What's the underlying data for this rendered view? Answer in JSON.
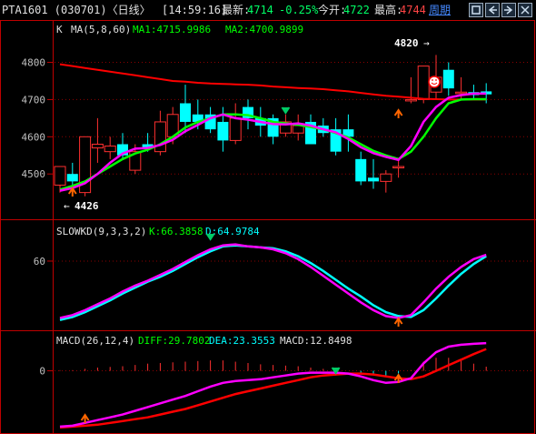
{
  "title_bar": {
    "symbol_title": "PTA1601 (030701)〈日线〉",
    "time": "[14:59:16]",
    "latest_label": "最新:",
    "latest_value": "4714",
    "change_pct": "-0.25%",
    "open_label": "今开:",
    "open_value": "4722",
    "high_label": "最高:",
    "high_value": "4744",
    "period_link": "周期",
    "nav_buttons": [
      "box-icon",
      "arrow-left-icon",
      "arrow-right-icon",
      "close-icon"
    ]
  },
  "colors": {
    "up": "#ff3030",
    "down": "#00ffff",
    "ma1": "#ff00ff",
    "ma2": "#00ff00",
    "ma3": "#ff0000",
    "grid": "#8b0000",
    "axis_text": "#c0c0c0"
  },
  "chart_data": [
    {
      "type": "candlestick",
      "panel": "main",
      "legend_prefix": "K",
      "legend_ma_params": "MA(5,8,60)",
      "legend_ma1": "MA1:4715.9986",
      "legend_ma2": "MA2:4700.9899",
      "y_ticks": [
        "4800",
        "4700",
        "4600",
        "4500"
      ],
      "ylim": [
        4410,
        4860
      ],
      "annotation_high": "4820",
      "annotation_low": "4426",
      "candles": [
        {
          "o": 4470,
          "h": 4520,
          "l": 4450,
          "c": 4520
        },
        {
          "o": 4500,
          "h": 4530,
          "l": 4470,
          "c": 4480
        },
        {
          "o": 4450,
          "h": 4600,
          "l": 4440,
          "c": 4600
        },
        {
          "o": 4570,
          "h": 4650,
          "l": 4530,
          "c": 4580
        },
        {
          "o": 4560,
          "h": 4600,
          "l": 4540,
          "c": 4575
        },
        {
          "o": 4580,
          "h": 4610,
          "l": 4540,
          "c": 4550
        },
        {
          "o": 4510,
          "h": 4580,
          "l": 4500,
          "c": 4560
        },
        {
          "o": 4580,
          "h": 4610,
          "l": 4560,
          "c": 4570
        },
        {
          "o": 4560,
          "h": 4670,
          "l": 4550,
          "c": 4640
        },
        {
          "o": 4600,
          "h": 4680,
          "l": 4580,
          "c": 4660
        },
        {
          "o": 4690,
          "h": 4740,
          "l": 4610,
          "c": 4640
        },
        {
          "o": 4660,
          "h": 4700,
          "l": 4620,
          "c": 4640
        },
        {
          "o": 4660,
          "h": 4680,
          "l": 4610,
          "c": 4620
        },
        {
          "o": 4640,
          "h": 4680,
          "l": 4560,
          "c": 4590
        },
        {
          "o": 4590,
          "h": 4690,
          "l": 4580,
          "c": 4650
        },
        {
          "o": 4680,
          "h": 4700,
          "l": 4620,
          "c": 4650
        },
        {
          "o": 4650,
          "h": 4680,
          "l": 4600,
          "c": 4630
        },
        {
          "o": 4650,
          "h": 4660,
          "l": 4580,
          "c": 4600
        },
        {
          "o": 4610,
          "h": 4660,
          "l": 4600,
          "c": 4640
        },
        {
          "o": 4610,
          "h": 4660,
          "l": 4590,
          "c": 4630
        },
        {
          "o": 4640,
          "h": 4660,
          "l": 4590,
          "c": 4580
        },
        {
          "o": 4630,
          "h": 4650,
          "l": 4600,
          "c": 4610
        },
        {
          "o": 4620,
          "h": 4650,
          "l": 4550,
          "c": 4560
        },
        {
          "o": 4620,
          "h": 4660,
          "l": 4560,
          "c": 4600
        },
        {
          "o": 4540,
          "h": 4560,
          "l": 4470,
          "c": 4480
        },
        {
          "o": 4490,
          "h": 4540,
          "l": 4460,
          "c": 4480
        },
        {
          "o": 4480,
          "h": 4510,
          "l": 4450,
          "c": 4500
        },
        {
          "o": 4520,
          "h": 4540,
          "l": 4490,
          "c": 4520
        },
        {
          "o": 4700,
          "h": 4760,
          "l": 4690,
          "c": 4700
        },
        {
          "o": 4700,
          "h": 4790,
          "l": 4690,
          "c": 4790
        },
        {
          "o": 4720,
          "h": 4820,
          "l": 4700,
          "c": 4760
        },
        {
          "o": 4780,
          "h": 4800,
          "l": 4710,
          "c": 4730
        },
        {
          "o": 4720,
          "h": 4760,
          "l": 4700,
          "c": 4720
        },
        {
          "o": 4720,
          "h": 4740,
          "l": 4700,
          "c": 4712
        },
        {
          "o": 4722,
          "h": 4744,
          "l": 4690,
          "c": 4714
        }
      ],
      "ma1": [
        4455,
        4462,
        4475,
        4500,
        4530,
        4555,
        4568,
        4570,
        4578,
        4592,
        4615,
        4632,
        4650,
        4660,
        4650,
        4646,
        4640,
        4634,
        4633,
        4636,
        4630,
        4620,
        4612,
        4594,
        4572,
        4556,
        4546,
        4538,
        4575,
        4640,
        4680,
        4705,
        4712,
        4716,
        4716
      ],
      "ma2": [
        4458,
        4468,
        4480,
        4500,
        4520,
        4540,
        4555,
        4565,
        4580,
        4600,
        4625,
        4640,
        4650,
        4660,
        4660,
        4658,
        4650,
        4640,
        4636,
        4632,
        4626,
        4620,
        4610,
        4598,
        4580,
        4562,
        4550,
        4540,
        4560,
        4600,
        4650,
        4690,
        4700,
        4701,
        4701
      ],
      "ma3": [
        4795,
        4790,
        4785,
        4780,
        4775,
        4770,
        4765,
        4760,
        4755,
        4750,
        4748,
        4745,
        4743,
        4742,
        4741,
        4740,
        4738,
        4735,
        4733,
        4731,
        4730,
        4728,
        4725,
        4722,
        4718,
        4714,
        4710,
        4708,
        4705,
        4702,
        4701,
        4700,
        4700,
        4700,
        4700
      ]
    },
    {
      "type": "line",
      "panel": "slowkd",
      "legend_name": "SLOWKD(9,3,3,2)",
      "legend_k": "K:66.3858",
      "legend_d": "D:64.9784",
      "y_ticks": [
        "60"
      ],
      "ylim": [
        -4,
        85
      ],
      "series": [
        {
          "name": "K",
          "values": [
            2,
            5,
            10,
            16,
            22,
            29,
            35,
            40,
            46,
            52,
            59,
            66,
            72,
            76,
            77,
            75,
            74,
            72,
            68,
            62,
            54,
            45,
            36,
            27,
            18,
            10,
            4,
            2,
            5,
            18,
            32,
            44,
            54,
            62,
            66.4
          ]
        },
        {
          "name": "D",
          "values": [
            0,
            3,
            8,
            14,
            20,
            27,
            33,
            39,
            44,
            50,
            57,
            64,
            70,
            75,
            76,
            75,
            74,
            73,
            70,
            65,
            58,
            50,
            41,
            32,
            24,
            15,
            8,
            4,
            3,
            10,
            22,
            35,
            47,
            57,
            65.0
          ]
        }
      ]
    },
    {
      "type": "line",
      "panel": "macd",
      "legend_name": "MACD(26,12,4)",
      "legend_diff": "DIFF:29.7802",
      "legend_dea": "DEA:23.3553",
      "legend_macd": "MACD:12.8498",
      "y_ticks": [
        "0"
      ],
      "ylim": [
        -65,
        25
      ],
      "series": [
        {
          "name": "DIFF",
          "values": [
            -60,
            -59,
            -56,
            -53,
            -50,
            -47,
            -43,
            -39,
            -35,
            -31,
            -27,
            -22,
            -17,
            -13,
            -11,
            -10,
            -9,
            -7,
            -5,
            -3,
            -2,
            -2,
            -2,
            -3,
            -6,
            -10,
            -13,
            -12,
            -8,
            8,
            20,
            26,
            28,
            29,
            29.8
          ]
        },
        {
          "name": "DEA",
          "values": [
            -61,
            -60,
            -59,
            -58,
            -56,
            -54,
            -52,
            -50,
            -47,
            -44,
            -41,
            -37,
            -33,
            -29,
            -25,
            -22,
            -19,
            -16,
            -13,
            -10,
            -7,
            -5,
            -4,
            -3,
            -3,
            -4,
            -6,
            -8,
            -9,
            -6,
            0,
            6,
            12,
            18,
            23.4
          ]
        },
        {
          "name": "MACD",
          "values": [
            2,
            2,
            6,
            10,
            12,
            14,
            18,
            22,
            24,
            26,
            28,
            30,
            32,
            32,
            28,
            24,
            20,
            18,
            16,
            14,
            10,
            6,
            4,
            0,
            -6,
            -12,
            -14,
            -8,
            2,
            28,
            40,
            40,
            32,
            22,
            12.8
          ]
        }
      ]
    }
  ]
}
